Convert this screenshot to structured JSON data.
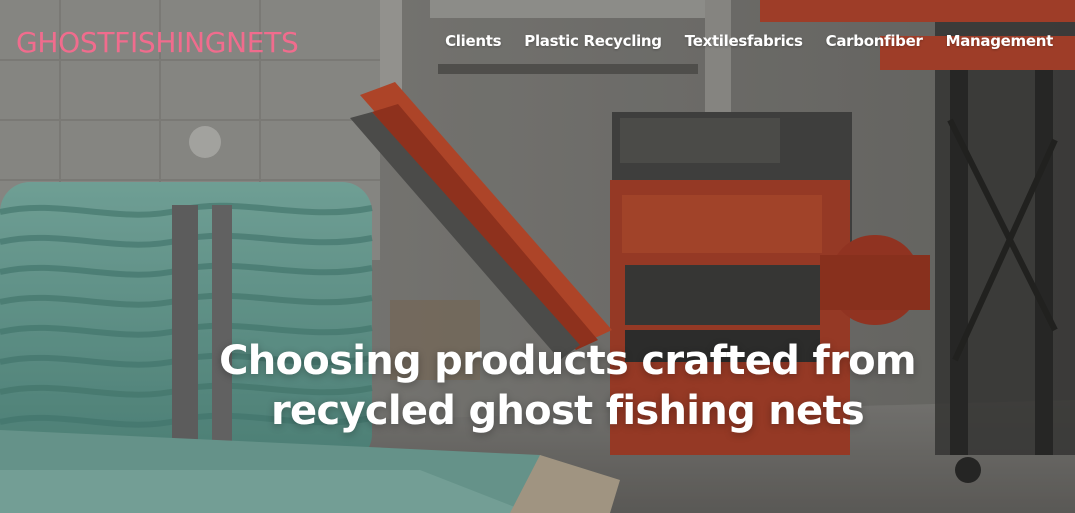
{
  "brand": {
    "name": "GHOSTFISHINGNETS",
    "color": "#f06c8d"
  },
  "nav": {
    "items": [
      {
        "label": "Clients"
      },
      {
        "label": "Plastic Recycling"
      },
      {
        "label": "Textilesfabrics"
      },
      {
        "label": "Carbonfiber"
      },
      {
        "label": "Management"
      }
    ]
  },
  "hero": {
    "headline_line1": "Choosing products crafted from",
    "headline_line2": "recycled ghost fishing nets",
    "text_color": "#ffffff",
    "image_description": "industrial recycling shredder with orange conveyor belt and bales of teal rope"
  }
}
